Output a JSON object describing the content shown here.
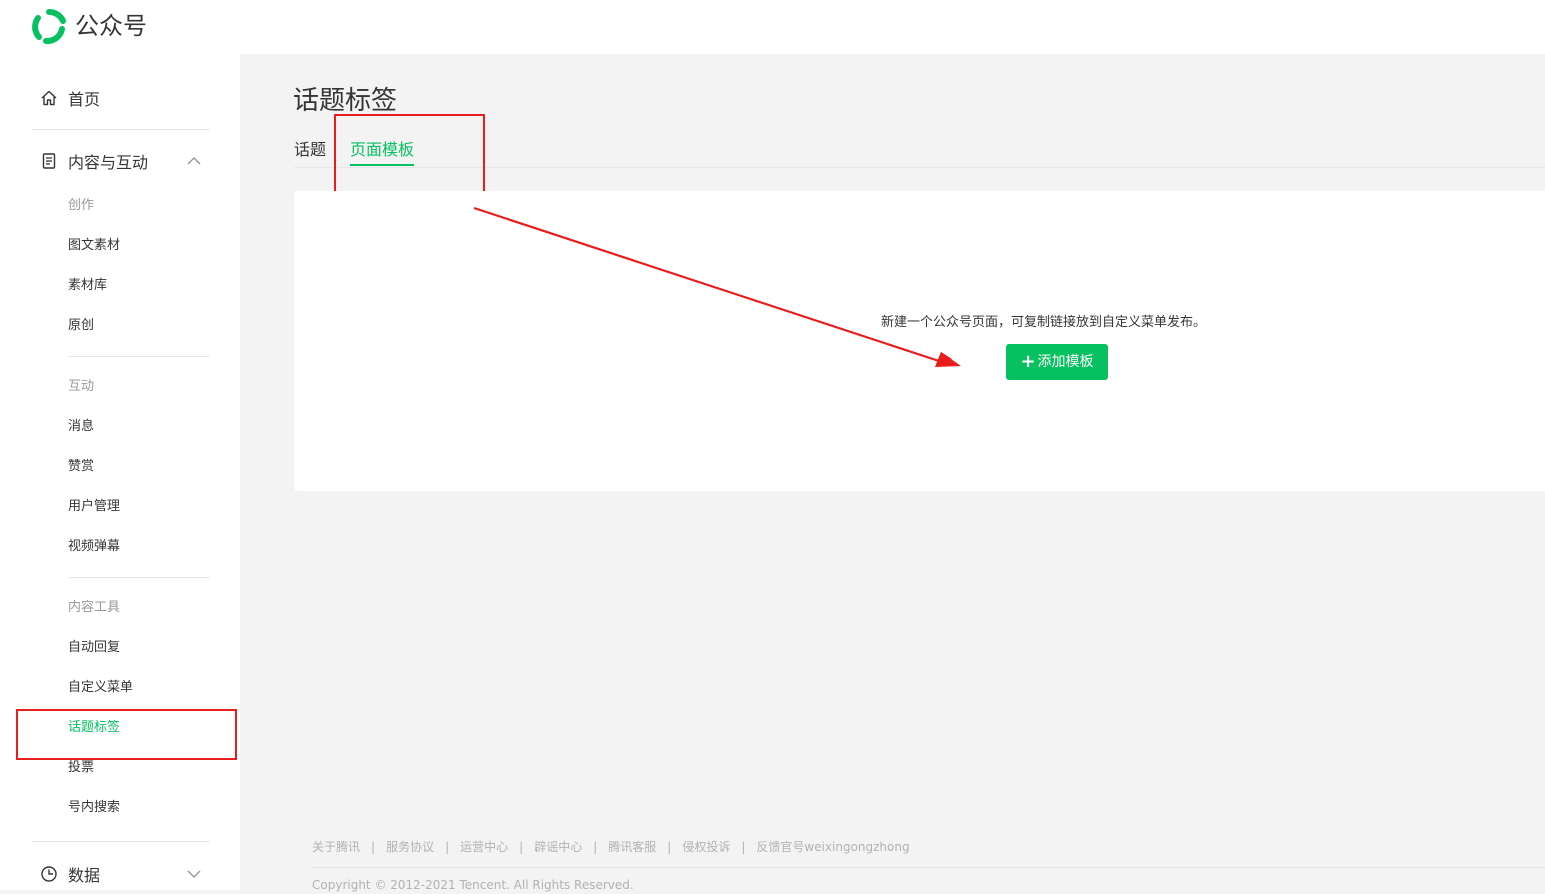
{
  "app": {
    "name": "公众号"
  },
  "colors": {
    "brand": "#07c160",
    "highlight": "#ea1d1d",
    "text": "#353535",
    "muted": "#9a9a9a"
  },
  "sidebar": {
    "home": {
      "label": "首页",
      "icon": "home-icon"
    },
    "content": {
      "label": "内容与互动",
      "icon": "document-icon",
      "expanded": true,
      "groups": [
        {
          "title": "创作",
          "items": [
            "图文素材",
            "素材库",
            "原创"
          ]
        },
        {
          "title": "互动",
          "items": [
            "消息",
            "赞赏",
            "用户管理",
            "视频弹幕"
          ]
        },
        {
          "title": "内容工具",
          "items": [
            "自动回复",
            "自定义菜单",
            "话题标签",
            "投票",
            "号内搜索"
          ]
        }
      ],
      "active_item": "话题标签"
    },
    "data": {
      "label": "数据",
      "icon": "clock-icon",
      "expanded": false
    }
  },
  "main": {
    "title": "话题标签",
    "tabs": [
      {
        "label": "话题",
        "active": false
      },
      {
        "label": "页面模板",
        "active": true
      }
    ],
    "empty_text": "新建一个公众号页面，可复制链接放到自定义菜单发布。",
    "add_button": {
      "plus": "+",
      "label": "添加模板"
    }
  },
  "footer": {
    "links": [
      "关于腾讯",
      "服务协议",
      "运营中心",
      "辟谣中心",
      "腾讯客服",
      "侵权投诉",
      "反馈官号weixingongzhong"
    ],
    "separator": "|",
    "copyright": "Copyright © 2012-2021 Tencent. All Rights Reserved."
  }
}
